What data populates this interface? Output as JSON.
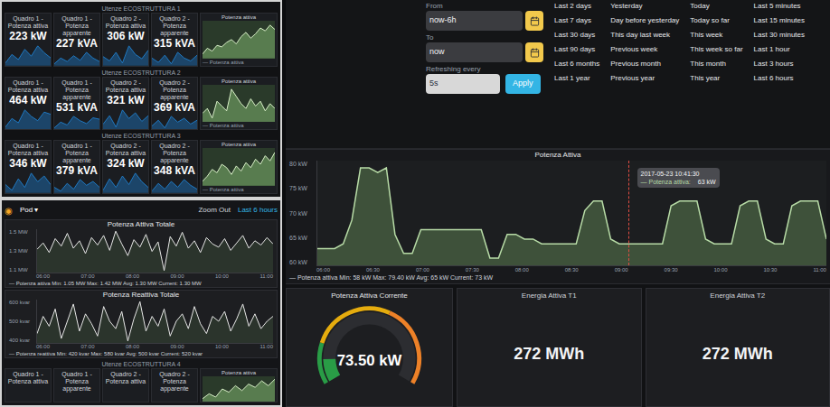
{
  "overview": {
    "rows": [
      {
        "title": "Utenze ECOSTRUTTURA 1",
        "stats": [
          {
            "label": "Quadro 1 - Potenza attiva",
            "value": "223 kW",
            "values": [
              40,
              45,
              42,
              48,
              44,
              50,
              46,
              43
            ]
          },
          {
            "label": "Quadro 1 - Potenza apparente",
            "value": "227 kVA",
            "values": [
              42,
              47,
              44,
              49,
              45,
              52,
              47,
              44
            ]
          },
          {
            "label": "Quadro 2 - Potenza attiva",
            "value": "306 kW",
            "values": [
              50,
              48,
              52,
              47,
              55,
              51,
              49,
              53
            ]
          },
          {
            "label": "Quadro 2 - Potenza apparente",
            "value": "315 kVA",
            "values": [
              52,
              49,
              54,
              48,
              56,
              52,
              50,
              54
            ]
          }
        ],
        "chart": {
          "title": "Potenza attiva",
          "legend": "— Potenza attiva",
          "values": [
            30,
            34,
            32,
            36,
            35,
            38,
            40,
            37,
            42,
            45,
            41,
            44,
            48,
            46,
            50,
            47
          ]
        }
      },
      {
        "title": "Utenze ECOSTRUTTURA 2",
        "stats": [
          {
            "label": "Quadro 1 - Potenza attiva",
            "value": "464 kW",
            "values": [
              44,
              48,
              46,
              52,
              49,
              47,
              51,
              50
            ]
          },
          {
            "label": "Quadro 1 - Potenza apparente",
            "value": "531 kVA",
            "values": [
              46,
              50,
              48,
              54,
              51,
              49,
              53,
              52
            ]
          },
          {
            "label": "Quadro 2 - Potenza attiva",
            "value": "321 kW",
            "values": [
              41,
              44,
              40,
              46,
              43,
              45,
              42,
              44
            ]
          },
          {
            "label": "Quadro 2 - Potenza apparente",
            "value": "369 kVA",
            "values": [
              43,
              46,
              42,
              48,
              45,
              47,
              44,
              46
            ]
          }
        ],
        "chart": {
          "title": "Potenza attiva",
          "legend": "— Potenza attiva",
          "values": [
            40,
            42,
            38,
            45,
            43,
            41,
            50,
            47,
            44,
            42,
            46,
            43,
            45,
            41,
            44,
            42
          ]
        }
      },
      {
        "title": "Utenze ECOSTRUTTURA 3",
        "stats": [
          {
            "label": "Quadro 1 - Potenza attiva",
            "value": "346 kW",
            "values": [
              45,
              43,
              47,
              44,
              49,
              46,
              48,
              45
            ]
          },
          {
            "label": "Quadro 1 - Potenza apparente",
            "value": "379 kVA",
            "values": [
              47,
              45,
              49,
              46,
              51,
              48,
              50,
              47
            ]
          },
          {
            "label": "Quadro 2 - Potenza attiva",
            "value": "324 kW",
            "values": [
              42,
              46,
              43,
              47,
              44,
              48,
              45,
              43
            ]
          },
          {
            "label": "Quadro 2 - Potenza apparente",
            "value": "348 kVA",
            "values": [
              44,
              48,
              45,
              49,
              46,
              50,
              47,
              45
            ]
          }
        ],
        "chart": {
          "title": "Potenza attiva",
          "legend": "— Potenza attiva",
          "values": [
            35,
            38,
            42,
            40,
            45,
            43,
            39,
            44,
            41,
            46,
            43,
            48,
            45,
            50,
            47,
            52
          ]
        }
      }
    ]
  },
  "detail": {
    "header": {
      "logo": "◉",
      "dashboard": "Pod ▾",
      "zoom": "Zoom Out",
      "range": "Last 6 hours"
    },
    "charts": [
      {
        "title": "Potenza Attiva Totale",
        "y_ticks": [
          "1.5 MW",
          "1.3 MW",
          "1.1 MW"
        ],
        "x_ticks": [
          "06:00",
          "07:00",
          "08:00",
          "09:00",
          "10:00",
          "11:00"
        ],
        "legend": "— Potenza attiva  Min: 1.05 MW  Max: 1.42 MW  Avg: 1.30 MW  Current: 1.30 MW",
        "values": [
          1.25,
          1.31,
          1.22,
          1.35,
          1.28,
          1.4,
          1.26,
          1.33,
          1.21,
          1.36,
          1.29,
          1.38,
          1.24,
          1.42,
          1.3,
          1.19,
          1.34,
          1.27,
          1.39,
          1.23,
          1.32,
          1.05,
          1.37,
          1.28,
          1.41,
          1.26,
          1.33,
          1.22,
          1.36,
          1.3,
          1.27,
          1.35,
          1.24,
          1.31,
          1.38,
          1.26,
          1.33,
          1.29,
          1.36,
          1.3
        ]
      },
      {
        "title": "Potenza Reattiva Totale",
        "y_ticks": [
          "600 kvar",
          "500 kvar",
          "400 kvar"
        ],
        "x_ticks": [
          "06:00",
          "07:00",
          "08:00",
          "09:00",
          "10:00",
          "11:00"
        ],
        "legend": "— Potenza reattiva  Min: 420 kvar  Max: 580 kvar  Avg: 500 kvar  Current: 520 kvar",
        "values": [
          0.45,
          0.52,
          0.48,
          0.55,
          0.43,
          0.5,
          0.57,
          0.46,
          0.53,
          0.49,
          0.44,
          0.56,
          0.5,
          0.47,
          0.54,
          0.42,
          0.51,
          0.58,
          0.46,
          0.52,
          0.48,
          0.55,
          0.44,
          0.5,
          0.53,
          0.47,
          0.56,
          0.49,
          0.45,
          0.52,
          0.5,
          0.54,
          0.46,
          0.51,
          0.57,
          0.48,
          0.53,
          0.47,
          0.5,
          0.52
        ]
      }
    ],
    "strip": {
      "title": "Utenze ECOSTRUTTURA 4",
      "labels": [
        "Quadro 1 - Potenza attiva",
        "Quadro 1 - Potenza apparente",
        "Quadro 2 - Potenza attiva",
        "Quadro 2 - Potenza apparente"
      ],
      "chart": {
        "title": "Potenza attiva",
        "values": [
          38,
          41,
          39,
          44,
          42,
          46,
          43,
          47,
          45,
          49,
          46,
          50
        ]
      }
    }
  },
  "time_picker": {
    "fields": [
      {
        "label": "From",
        "value": "now-6h",
        "button": "calendar"
      },
      {
        "label": "To",
        "value": "now",
        "button": "calendar"
      }
    ],
    "refresh": {
      "label": "Refreshing every",
      "value": "5s",
      "button": "Apply"
    },
    "quick_ranges": [
      [
        "Last 2 days",
        "Last 7 days",
        "Last 30 days",
        "Last 90 days",
        "Last 6 months",
        "Last 1 year"
      ],
      [
        "Yesterday",
        "Day before yesterday",
        "This day last week",
        "Previous week",
        "Previous month",
        "Previous year"
      ],
      [
        "Today",
        "Today so far",
        "This week",
        "This week so far",
        "This month",
        "This year"
      ],
      [
        "Last 5 minutes",
        "Last 15 minutes",
        "Last 30 minutes",
        "Last 1 hour",
        "Last 3 hours",
        "Last 6 hours"
      ]
    ]
  },
  "main_chart": {
    "title": "Potenza Attiva",
    "y_ticks": [
      "80 kW",
      "75 kW",
      "70 kW",
      "65 kW",
      "60 kW"
    ],
    "x_ticks": [
      "06:00",
      "06:30",
      "07:00",
      "07:30",
      "08:00",
      "08:30",
      "09:00",
      "09:30",
      "10:00",
      "10:30",
      "11:00"
    ],
    "legend": "— Potenza attiva  Min: 58 kW  Max: 79.40 kW  Avg: 65 kW  Current: 73 kW",
    "values": [
      62,
      62,
      62,
      63,
      68,
      79,
      79,
      78,
      79,
      65,
      61,
      61,
      66,
      66,
      66,
      66,
      66,
      66,
      66,
      66,
      60,
      60,
      65,
      65,
      64,
      64,
      63,
      63,
      63,
      63,
      63,
      70,
      72,
      72,
      64,
      63,
      63,
      63,
      63,
      63,
      63,
      71,
      72,
      72,
      72,
      64,
      63,
      63,
      63,
      71,
      72,
      72,
      64,
      63,
      63,
      71,
      72,
      72,
      72,
      64
    ],
    "crosshair_index": 36,
    "tooltip": {
      "time": "2017-05-23 10:41:30",
      "series": "— Potenza attiva:",
      "value": "63 kW"
    }
  },
  "gauge": {
    "title": "Potenza Attiva Corrente",
    "value": "73.50 kW",
    "level": 0.12,
    "color": "#299c46",
    "thresholds": [
      {
        "level": 0.2,
        "color": "#299c46"
      },
      {
        "level": 0.6,
        "color": "#e5ac0e"
      },
      {
        "level": 1,
        "color": "#ed8128"
      }
    ]
  },
  "stats": [
    {
      "title": "Energia Attiva T1",
      "value": "272 MWh"
    },
    {
      "title": "Energia Attiva T2",
      "value": "272 MWh"
    }
  ]
}
